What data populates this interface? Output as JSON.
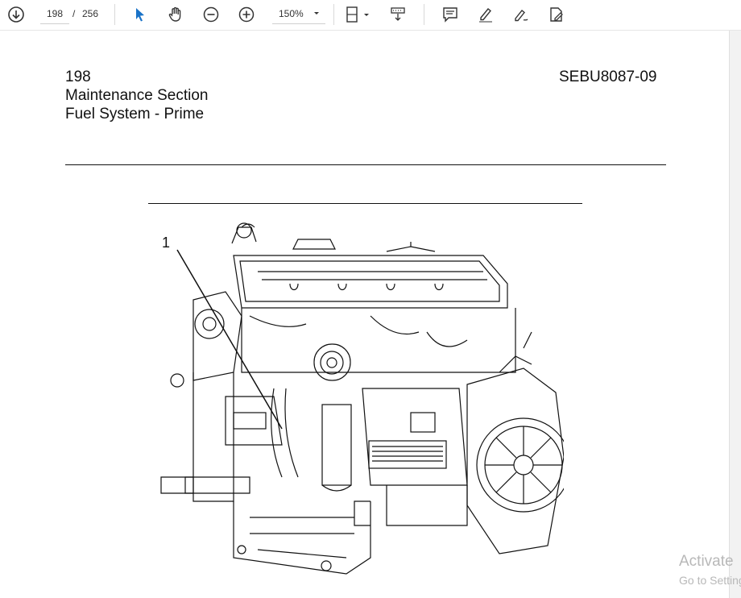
{
  "toolbar": {
    "current_page": "198",
    "page_separator": "/",
    "total_pages": "256",
    "zoom_value": "150%"
  },
  "document": {
    "page_number": "198",
    "section": "Maintenance Section",
    "topic": "Fuel System - Prime",
    "doc_code": "SEBU8087-09",
    "callout_label": "1"
  },
  "watermark": {
    "line1": "Activate",
    "line2": "Go to Settings"
  }
}
